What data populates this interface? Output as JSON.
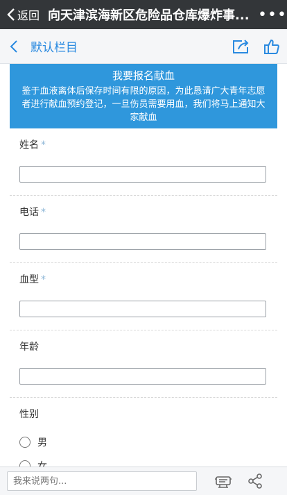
{
  "topbar": {
    "back_label": "返回",
    "title": "向天津滨海新区危险品仓库爆炸事...",
    "more_label": "•••"
  },
  "subbar": {
    "title": "默认栏目"
  },
  "banner": {
    "title": "我要报名献血",
    "text": "鉴于血液离体后保存时间有限的原因，为此恳请广大青年志愿者进行献血预约登记，一旦伤员需要用血，我们将马上通知大家献血"
  },
  "form": {
    "fields": [
      {
        "label": "姓名",
        "required_mark": "*"
      },
      {
        "label": "电话",
        "required_mark": "*"
      },
      {
        "label": "血型",
        "required_mark": "*"
      },
      {
        "label": "年龄"
      }
    ],
    "gender": {
      "label": "性别",
      "options": [
        "男",
        "女"
      ]
    }
  },
  "bottombar": {
    "comment_placeholder": "我来说两句..."
  },
  "colors": {
    "topbar_bg": "#333639",
    "accent_blue": "#2a8ae0",
    "banner_bg": "#2f97dc"
  }
}
